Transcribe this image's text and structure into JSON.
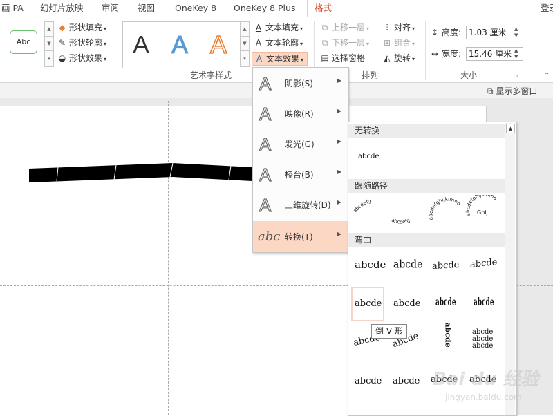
{
  "tabs": [
    "画 PA",
    "幻灯片放映",
    "审阅",
    "视图",
    "OneKey 8",
    "OneKey 8 Plus",
    "格式"
  ],
  "account": "登录",
  "shape_styles": {
    "sample": "Abc",
    "fill": "形状填充",
    "outline": "形状轮廓",
    "effects": "形状效果"
  },
  "wordart": {
    "letters": [
      "A",
      "A",
      "A"
    ],
    "colors": [
      "#111111",
      "#5b9bd5",
      "#ed7d31"
    ],
    "text_fill": "文本填充",
    "text_outline": "文本轮廓",
    "text_effects": "文本效果",
    "group_label": "艺术字样式"
  },
  "arrange": {
    "bring_forward": "上移一层",
    "send_backward": "下移一层",
    "selection_pane": "选择窗格",
    "align": "对齐",
    "group": "组合",
    "rotate": "旋转",
    "group_label": "排列"
  },
  "size": {
    "height_label": "高度:",
    "height_value": "1.03 厘米",
    "width_label": "宽度:",
    "width_value": "15.46 厘米",
    "group_label": "大小"
  },
  "show_multiple_windows": "显示多窗口",
  "effects_menu": [
    {
      "label": "阴影(S)",
      "icon": "shadow-icon"
    },
    {
      "label": "映像(R)",
      "icon": "reflection-icon"
    },
    {
      "label": "发光(G)",
      "icon": "glow-icon"
    },
    {
      "label": "棱台(B)",
      "icon": "bevel-icon"
    },
    {
      "label": "三维旋转(D)",
      "icon": "3d-rotation-icon"
    },
    {
      "label": "转换(T)",
      "icon": "transform-icon"
    }
  ],
  "transform": {
    "section_no_transform": "无转换",
    "section_follow_path": "跟随路径",
    "section_warp": "弯曲",
    "sample": "abcde",
    "path_sample_1": "abcdefg",
    "path_sample_2": "abcdefghijklmno",
    "path_sample_3": "Ghij",
    "tooltip": "倒 V 形"
  },
  "watermark": {
    "line1": "Bai du 经验",
    "line2": "jingyan.baidu.com"
  },
  "colors": {
    "accent": "#d24726",
    "menu_selected": "#fcd7c3",
    "tooltip_border": "#888888"
  }
}
